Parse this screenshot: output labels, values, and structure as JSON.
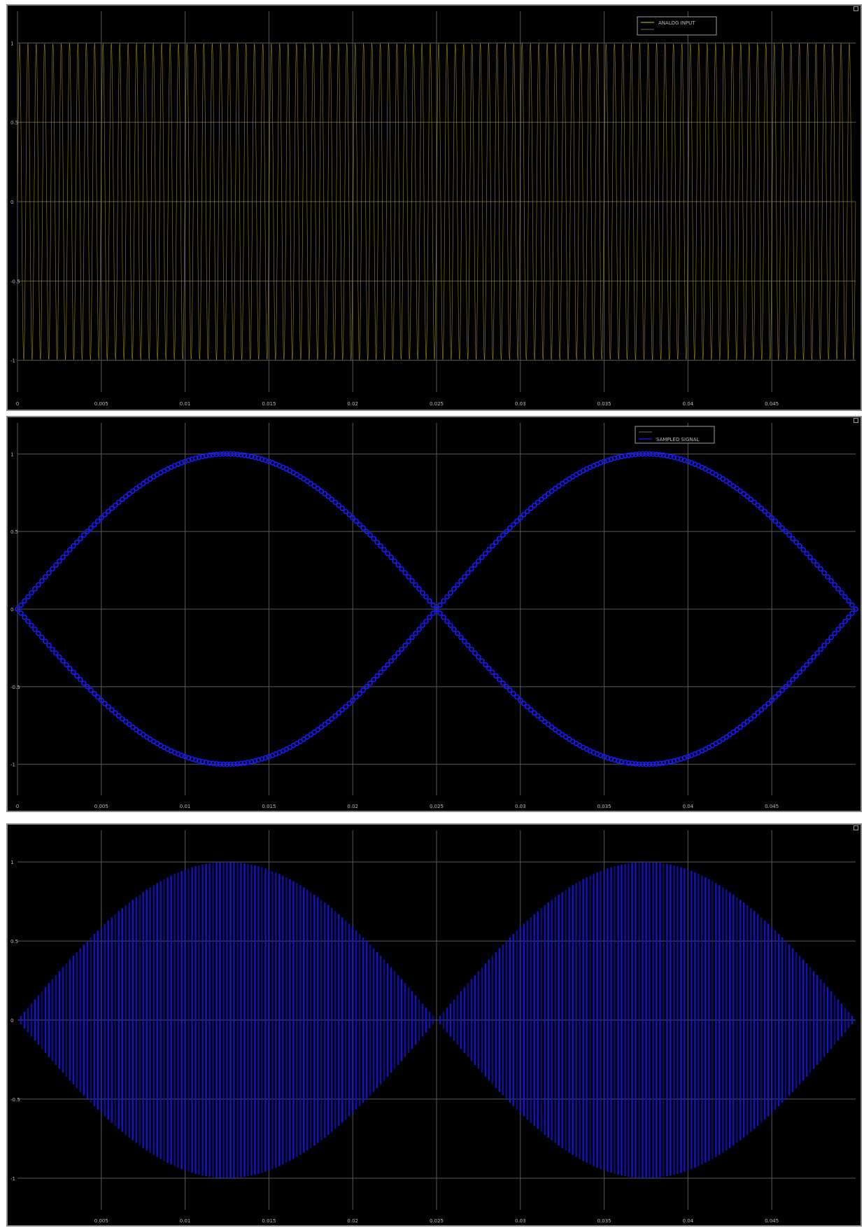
{
  "colors": {
    "background": "#000000",
    "grid": "#5a5a5a",
    "tick_text": "#bdbdbd",
    "panel1_signal": "#b5a40a",
    "panel2_signal": "#1a1aff",
    "panel3_signal": "#1414d6",
    "legend_border": "#a0a0a0"
  },
  "chart_data": [
    {
      "type": "line",
      "title": "",
      "xlabel": "",
      "ylabel": "",
      "xlim": [
        0,
        0.05
      ],
      "ylim": [
        -1.2,
        1.2
      ],
      "x_ticks": [
        0,
        0.005,
        0.01,
        0.015,
        0.02,
        0.025,
        0.03,
        0.035,
        0.04,
        0.045
      ],
      "x_tick_labels": [
        "0",
        "0.005",
        "0.01",
        "0.015",
        "0.02",
        "0.025",
        "0.03",
        "0.035",
        "0.04",
        "0.045"
      ],
      "y_ticks": [
        1,
        0.5,
        0,
        -0.5,
        -1
      ],
      "y_tick_labels": [
        "1",
        "0.5",
        "0",
        "-0.5",
        "-1"
      ],
      "grid": true,
      "legend_position": "top-right",
      "legend_entries": [
        "ANALOG INPUT",
        ""
      ],
      "series": [
        {
          "name": "ANALOG INPUT",
          "color": "#b5a40a",
          "amplitude": 1,
          "carrier_frequency_hz": 2000,
          "description_shape": "dense full-amplitude oscillation"
        }
      ]
    },
    {
      "type": "scatter",
      "title": "",
      "xlabel": "",
      "ylabel": "",
      "xlim": [
        0,
        0.05
      ],
      "ylim": [
        -1.2,
        1.2
      ],
      "x_ticks": [
        0,
        0.005,
        0.01,
        0.015,
        0.02,
        0.025,
        0.03,
        0.035,
        0.04,
        0.045
      ],
      "x_tick_labels": [
        "0",
        "0.005",
        "0.01",
        "0.015",
        "0.02",
        "0.025",
        "0.03",
        "0.035",
        "0.04",
        "0.045"
      ],
      "y_ticks": [
        1,
        0.5,
        0,
        -0.5,
        -1
      ],
      "y_tick_labels": [
        "1",
        "0.5",
        "0",
        "-0.5",
        "-1"
      ],
      "grid": true,
      "legend_position": "top-right",
      "legend_entries": [
        "",
        "SAMPLED SIGNAL"
      ],
      "series": [
        {
          "name": "SAMPLED SIGNAL",
          "color": "#1a1aff",
          "envelope": "±sin(2π·20·t)",
          "sample_count": 240
        }
      ]
    },
    {
      "type": "line",
      "title": "",
      "xlabel": "",
      "ylabel": "",
      "xlim": [
        0,
        0.05
      ],
      "ylim": [
        -1.2,
        1.2
      ],
      "x_ticks": [
        0.005,
        0.01,
        0.015,
        0.02,
        0.025,
        0.03,
        0.035,
        0.04,
        0.045
      ],
      "x_tick_labels": [
        "0.005",
        "0.01",
        "0.015",
        "0.02",
        "0.025",
        "0.03",
        "0.035",
        "0.04",
        "0.045"
      ],
      "y_ticks": [
        1,
        0.5,
        0,
        -0.5,
        -1
      ],
      "y_tick_labels": [
        "1",
        "0.5",
        "0",
        "-0.5",
        "-1"
      ],
      "grid": true,
      "series": [
        {
          "name": "",
          "color": "#1414d6",
          "envelope": "±sin(2π·20·t)",
          "line_count": 240
        }
      ]
    }
  ]
}
